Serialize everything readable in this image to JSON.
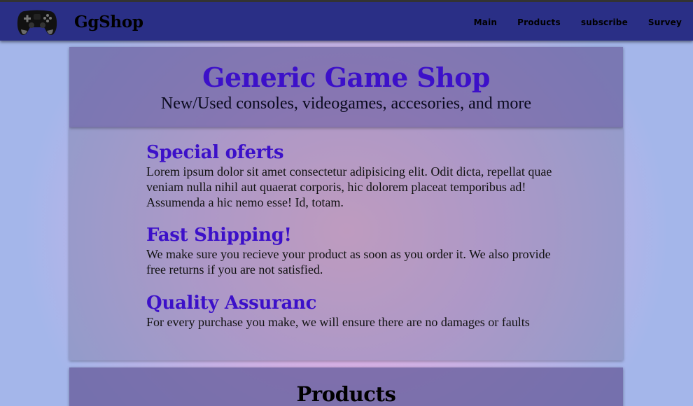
{
  "navbar": {
    "logo_icon": "gamepad-icon",
    "brand": "GgShop",
    "links": [
      "Main",
      "Products",
      "subscribe",
      "Survey"
    ],
    "background_color": "#2a2f86"
  },
  "hero": {
    "title": "Generic Game Shop",
    "subtitle": "New/Used consoles, videogames, accesories, and more",
    "title_color": "#3c10c9"
  },
  "features": [
    {
      "heading": "Special oferts",
      "text": "Lorem ipsum dolor sit amet consectetur adipisicing elit. Odit dicta, repellat quae veniam nulla nihil aut quaerat corporis, hic dolorem placeat temporibus ad! Assumenda a hic nemo esse! Id, totam."
    },
    {
      "heading": "Fast Shipping!",
      "text": "We make sure you recieve your product as soon as you order it. We also provide free returns if you are not satisfied."
    },
    {
      "heading": "Quality Assuranc",
      "text": "For every purchase you make, we will ensure there are no damages or faults"
    }
  ],
  "products": {
    "title": "Products"
  }
}
